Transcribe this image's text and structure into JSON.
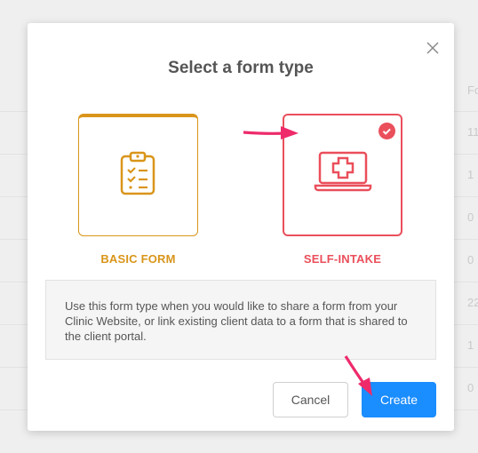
{
  "background": {
    "column_header": "Fo",
    "values": [
      "11",
      "1",
      "0",
      "0",
      "22",
      "1",
      "0"
    ]
  },
  "modal": {
    "title": "Select a form type",
    "close_icon": "close-icon",
    "cards": [
      {
        "label": "BASIC FORM",
        "icon": "clipboard-checklist-icon",
        "color": "#d9951a",
        "selected": false
      },
      {
        "label": "SELF-INTAKE",
        "icon": "laptop-medical-cross-icon",
        "color": "#ea4f5b",
        "selected": true
      }
    ],
    "description": "Use this form type when you would like to share a form from your Clinic Website, or link existing client data to a form that is shared to the client portal.",
    "buttons": {
      "cancel": "Cancel",
      "create": "Create"
    },
    "accent_color": "#1a8dff"
  }
}
